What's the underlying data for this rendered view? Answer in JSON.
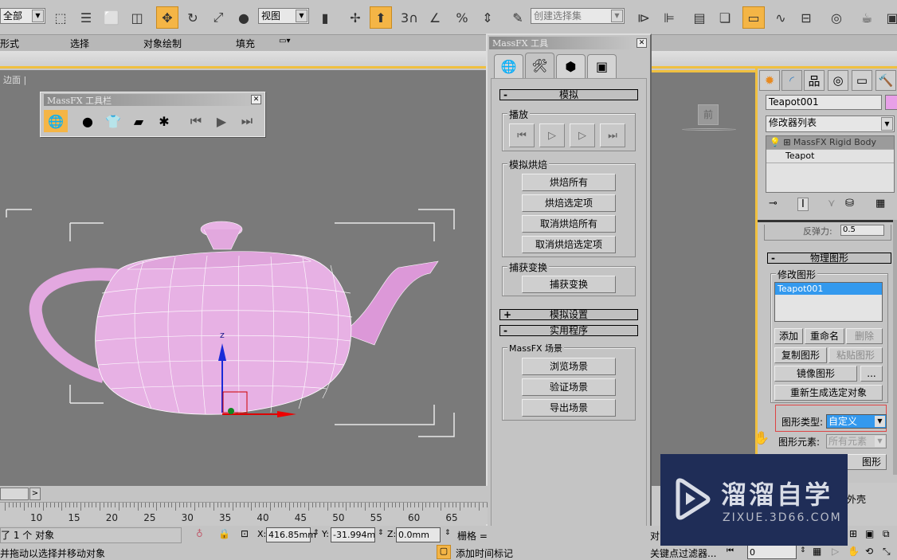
{
  "toolbar": {
    "selection_filter": "全部",
    "ref_coord": "视图",
    "named_selection_placeholder": "创建选择集",
    "snap_label": "3",
    "icons": [
      "select-object-icon",
      "select-by-name-icon",
      "rect-selection-icon",
      "window-crossing-icon",
      "move-icon",
      "rotate-icon",
      "scale-icon",
      "placement-icon",
      "mirror-icon",
      "pivot-icon",
      "manipulate-icon",
      "snap-toggle-icon",
      "angle-snap-icon",
      "percent-snap-icon",
      "spinner-snap-icon",
      "edit-named-sets-icon",
      "mirror-tool-icon",
      "align-icon",
      "layer-manager-icon",
      "scene-explorer-icon",
      "graphite-toggle-icon",
      "curve-editor-icon",
      "schematic-view-icon",
      "material-editor-icon",
      "render-setup-icon",
      "render-frame-icon"
    ]
  },
  "ribbon": {
    "tabs": [
      "形式",
      "选择",
      "对象绘制",
      "填充"
    ]
  },
  "viewport": {
    "label": "边面 |",
    "axis_label": "z",
    "viewcube_face": "前"
  },
  "massfx_toolbar": {
    "title": "MassFX 工具栏",
    "icons": [
      "world-params-icon",
      "rigid-body-icon",
      "mcloth-icon",
      "constraint-icon",
      "ragdoll-icon",
      "reset-sim-icon",
      "play-sim-icon",
      "step-sim-icon"
    ]
  },
  "massfx_tools": {
    "title": "MassFX 工具",
    "tabs": [
      "world-params-tab",
      "simulation-tools-tab",
      "multi-object-editor-tab",
      "display-options-tab"
    ],
    "rollout_simulation": {
      "label": "模拟",
      "sign": "-",
      "playback": {
        "label": "播放",
        "buttons": [
          "reset-icon",
          "play-icon",
          "step-icon",
          "bake-icon"
        ]
      },
      "bake": {
        "label": "模拟烘焙",
        "buttons": [
          "烘焙所有",
          "烘焙选定项",
          "取消烘焙所有",
          "取消烘焙选定项"
        ]
      },
      "capture": {
        "label": "捕获变换",
        "button": "捕获变换"
      }
    },
    "rollout_settings": {
      "label": "模拟设置",
      "sign": "+"
    },
    "rollout_utilities": {
      "label": "实用程序",
      "sign": "-",
      "scene_group": {
        "label": "MassFX 场景",
        "buttons": [
          "浏览场景",
          "验证场景",
          "导出场景"
        ]
      }
    }
  },
  "command_panel": {
    "tabs": [
      "create-tab",
      "modify-tab",
      "hierarchy-tab",
      "motion-tab",
      "display-tab",
      "utilities-tab"
    ],
    "object_name": "Teapot001",
    "object_color": "#e8a0e8",
    "modifier_list": "修改器列表",
    "stack": [
      "MassFX Rigid Body",
      "Teapot"
    ],
    "cropped_param": "反弹力:",
    "cropped_value": "0.5",
    "rollout_physical_shapes": {
      "label": "物理图形",
      "sign": "-",
      "modify_group_label": "修改图形",
      "shape_list": [
        "Teapot001"
      ],
      "buttons": {
        "add": "添加",
        "rename": "重命名",
        "delete": "删除",
        "copy": "复制图形",
        "paste": "粘贴图形",
        "mirror": "镜像图形",
        "more": "...",
        "regenerate": "重新生成选定对象"
      },
      "shape_type_label": "图形类型:",
      "shape_type_value": "自定义",
      "shape_element_label": "图形元素:",
      "shape_element_value": "所有元素",
      "cropped_btn": "图形",
      "cropped_text": "外壳"
    }
  },
  "timeline": {
    "ticks": [
      "10",
      "15",
      "20",
      "25",
      "30",
      "35",
      "40",
      "45",
      "50",
      "55",
      "60",
      "65"
    ],
    "nav_next": ">"
  },
  "status": {
    "selected": "了 1 个 对象",
    "prompt": "并拖动以选择并移动对象",
    "x_label": "X:",
    "x_value": "416.85mm",
    "y_label": "Y:",
    "y_value": "-31.994mm",
    "z_label": "Z:",
    "z_value": "0.0mm",
    "grid_label": "栅格 =",
    "add_time_tag": "添加时间标记",
    "key_filter": "关键点过滤器...",
    "frame_value": "0",
    "cropped_obj": "对"
  },
  "watermark": {
    "brand": "溜溜自学",
    "url": "ZIXUE.3D66.COM"
  }
}
